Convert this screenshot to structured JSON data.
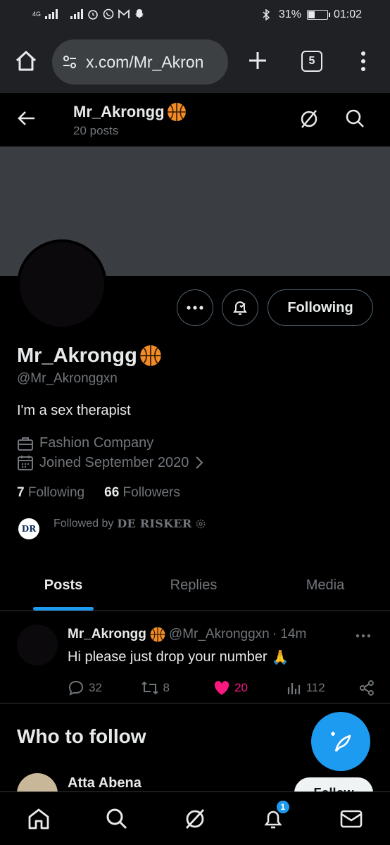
{
  "status_bar": {
    "network": "4G",
    "battery_text": "31%",
    "battery_level": 0.31,
    "time": "01:02"
  },
  "browser": {
    "url": "x.com/Mr_Akron",
    "tab_count": "5"
  },
  "header": {
    "name": "Mr_Akrongg",
    "posts_count": "20 posts"
  },
  "profile": {
    "following_button": "Following",
    "display_name": "Mr_Akrongg",
    "handle": "@Mr_Akronggxn",
    "bio": "I'm a sex therapist",
    "category": "Fashion Company",
    "joined": "Joined September 2020",
    "following_count": "7",
    "following_label": "Following",
    "followers_count": "66",
    "followers_label": "Followers",
    "followed_by_prefix": "Followed by",
    "followed_by_name": "DE RISKER",
    "followed_by_avatar_text": "DR"
  },
  "tabs": [
    {
      "label": "Posts",
      "active": true
    },
    {
      "label": "Replies",
      "active": false
    },
    {
      "label": "Media",
      "active": false
    }
  ],
  "post": {
    "name": "Mr_Akrongg",
    "handle": "@Mr_Akronggxn",
    "time": "· 14m",
    "text": "Hi please just drop your number",
    "emoji": "🙏",
    "replies": "32",
    "reposts": "8",
    "likes": "20",
    "views": "112"
  },
  "who_to_follow": {
    "title": "Who to follow",
    "suggestion_name": "Atta Abena",
    "follow_button": "Follow"
  },
  "bottom_nav": {
    "notification_badge": "1"
  },
  "colors": {
    "accent": "#1d9bf0",
    "like": "#f91880",
    "muted": "#71767b",
    "banner": "#3a3d41",
    "browser_chrome": "#202124"
  }
}
